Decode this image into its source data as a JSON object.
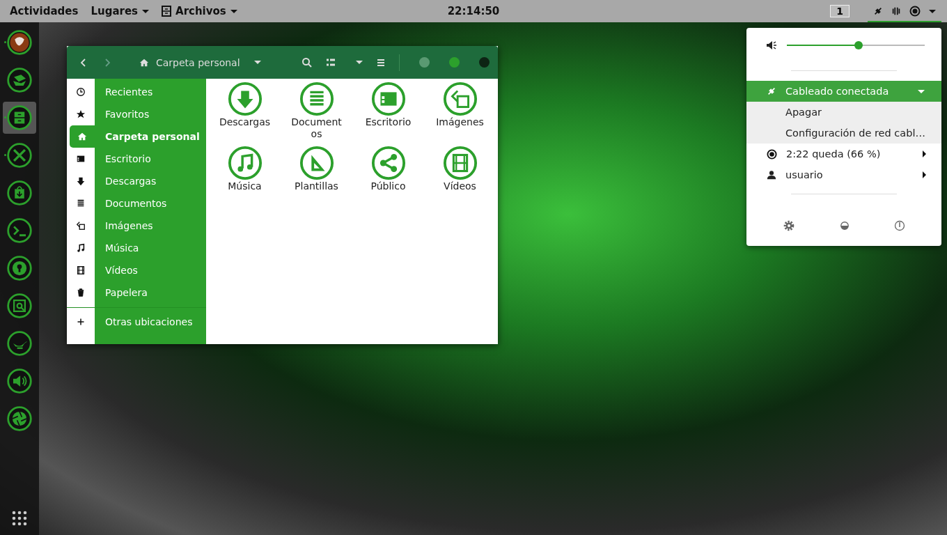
{
  "top_bar": {
    "activities": "Actividades",
    "places_menu": "Lugares",
    "app_menu": "Archivos",
    "clock": "22:14:50",
    "workspace": "1"
  },
  "dock": [
    {
      "kind": "firefox",
      "running": true,
      "selected": false
    },
    {
      "kind": "mail",
      "running": false,
      "selected": false
    },
    {
      "kind": "files",
      "running": true,
      "selected": true
    },
    {
      "kind": "tools",
      "running": true,
      "selected": false
    },
    {
      "kind": "store",
      "running": false,
      "selected": false
    },
    {
      "kind": "terminal",
      "running": false,
      "selected": false
    },
    {
      "kind": "keyring",
      "running": false,
      "selected": false
    },
    {
      "kind": "screenshot",
      "running": false,
      "selected": false
    },
    {
      "kind": "lamp",
      "running": false,
      "selected": false
    },
    {
      "kind": "sound",
      "running": false,
      "selected": false
    },
    {
      "kind": "aperture",
      "running": false,
      "selected": false
    }
  ],
  "file_manager": {
    "location": "Carpeta personal",
    "sidebar": [
      {
        "label": "Recientes",
        "selected": false
      },
      {
        "label": "Favoritos",
        "selected": false
      },
      {
        "label": "Carpeta personal",
        "selected": true
      },
      {
        "label": "Escritorio",
        "selected": false
      },
      {
        "label": "Descargas",
        "selected": false
      },
      {
        "label": "Documentos",
        "selected": false
      },
      {
        "label": "Imágenes",
        "selected": false
      },
      {
        "label": "Música",
        "selected": false
      },
      {
        "label": "Vídeos",
        "selected": false
      },
      {
        "label": "Papelera",
        "selected": false
      }
    ],
    "other_locations": "Otras ubicaciones",
    "folders": [
      "Descargas",
      "Documentos",
      "Escritorio",
      "Imágenes",
      "Música",
      "Plantillas",
      "Público",
      "Vídeos"
    ]
  },
  "system_menu": {
    "volume": {
      "level": 0.52
    },
    "network": {
      "label": "Cableado conectada",
      "expanded": true,
      "items": [
        "Apagar",
        "Configuración de red cabl…"
      ]
    },
    "battery": "2:22 queda (66 %)",
    "user": "usuario"
  }
}
